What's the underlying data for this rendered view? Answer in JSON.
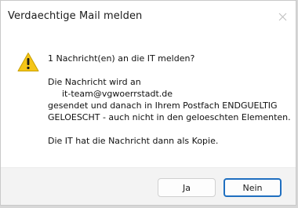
{
  "window": {
    "title": "Verdaechtige Mail melden",
    "close_icon": "close-icon"
  },
  "icon": {
    "name": "warning-icon",
    "fill": "#f5c518",
    "glyph": "!"
  },
  "message": {
    "line1": "1 Nachricht(en) an die IT melden?",
    "line2": "Die Nachricht wird an",
    "line3": "it-team@vgwoerrstadt.de",
    "line4": "gesendet und danach in Ihrem Postfach ENDGUELTIG",
    "line5": "GELOESCHT - auch nicht in den geloeschten Elementen.",
    "line6": "Die IT hat die Nachricht dann als Kopie."
  },
  "buttons": {
    "yes_label": "Ja",
    "no_label": "Nein",
    "focus_color": "#1f6fc0"
  }
}
